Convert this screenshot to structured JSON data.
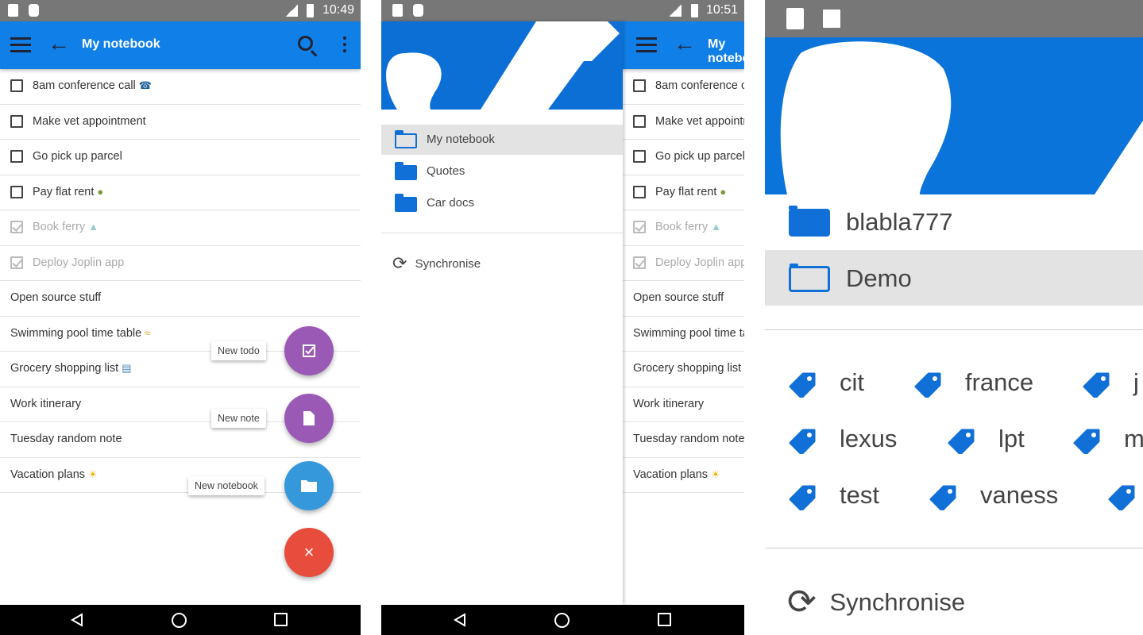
{
  "screen1": {
    "status_time": "10:49",
    "title": "My notebook",
    "notes": [
      {
        "title": "8am conference call",
        "todo": true,
        "done": false,
        "emoji": "telephone"
      },
      {
        "title": "Make vet appointment",
        "todo": true,
        "done": false
      },
      {
        "title": "Go pick up parcel",
        "todo": true,
        "done": false
      },
      {
        "title": "Pay flat rent",
        "todo": true,
        "done": false,
        "emoji": "money"
      },
      {
        "title": "Book ferry",
        "todo": true,
        "done": true,
        "emoji": "ship"
      },
      {
        "title": "Deploy Joplin app",
        "todo": true,
        "done": true
      },
      {
        "title": "Open source stuff",
        "todo": false
      },
      {
        "title": "Swimming pool time table",
        "todo": false,
        "emoji": "swimmer"
      },
      {
        "title": "Grocery shopping list",
        "todo": false,
        "emoji": "memo"
      },
      {
        "title": "Work itinerary",
        "todo": false
      },
      {
        "title": "Tuesday random note",
        "todo": false
      },
      {
        "title": "Vacation plans",
        "todo": false,
        "emoji": "sun"
      }
    ],
    "fab_actions": [
      {
        "label": "New todo",
        "icon": "checkbox-icon",
        "color": "#9b59b6"
      },
      {
        "label": "New note",
        "icon": "document-icon",
        "color": "#9b59b6"
      },
      {
        "label": "New notebook",
        "icon": "folder-icon",
        "color": "#3498db"
      }
    ],
    "fab_close": {
      "icon": "close-icon",
      "color": "#e74c3c",
      "glyph": "×"
    }
  },
  "screen2": {
    "status_time": "10:51",
    "title": "My notebook",
    "notebooks": [
      {
        "label": "My notebook",
        "selected": true
      },
      {
        "label": "Quotes",
        "selected": false
      },
      {
        "label": "Car docs",
        "selected": false
      }
    ],
    "sync_label": "Synchronise"
  },
  "screen3": {
    "notebooks": [
      {
        "label": "blabla777",
        "selected": false
      },
      {
        "label": "Demo",
        "selected": true
      }
    ],
    "tags": [
      [
        "cit",
        "france",
        "j"
      ],
      [
        "lexus",
        "lpt",
        "m"
      ],
      [
        "test",
        "vaness",
        ""
      ]
    ],
    "sync_label": "Synchronise"
  },
  "colors": {
    "accent": "#1080e8",
    "folder": "#1070d8",
    "status_bar": "#777777"
  }
}
